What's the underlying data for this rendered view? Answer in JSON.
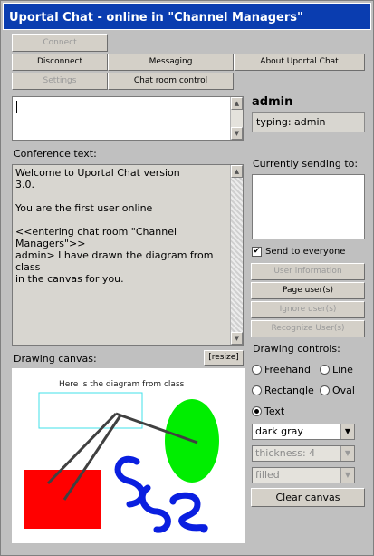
{
  "window": {
    "title": "Uportal Chat - online in \"Channel Managers\""
  },
  "toolbar": {
    "connect": "Connect",
    "disconnect": "Disconnect",
    "messaging": "Messaging",
    "about": "About Uportal Chat",
    "settings": "Settings",
    "chat_room_control": "Chat room control"
  },
  "input": {
    "value": ""
  },
  "user": {
    "name": "admin",
    "typing_status": "typing: admin"
  },
  "conference": {
    "label": "Conference text:",
    "text": "Welcome to Uportal Chat version\n3.0.\n\nYou are the first user online\n\n<<entering chat room \"Channel\nManagers\">>\nadmin> I have drawn the diagram from\nclass\nin the canvas for you."
  },
  "sending": {
    "label": "Currently sending to:",
    "send_to_everyone": "Send to everyone",
    "send_to_everyone_checked": true
  },
  "user_buttons": {
    "user_information": "User information",
    "page_users": "Page user(s)",
    "ignore_users": "Ignore user(s)",
    "recognize_users": "Recognize User(s)"
  },
  "canvas": {
    "label": "Drawing canvas:",
    "resize": "[resize]",
    "caption": "Here is the diagram from class",
    "colors": {
      "red": "#ff0000",
      "green": "#00ee00",
      "blue": "#0a1fe0",
      "cyan": "#40e0e8",
      "gray": "#404040"
    }
  },
  "drawing_controls": {
    "label": "Drawing controls:",
    "tools": [
      {
        "label": "Freehand",
        "selected": false
      },
      {
        "label": "Line",
        "selected": false
      },
      {
        "label": "Rectangle",
        "selected": false
      },
      {
        "label": "Oval",
        "selected": false
      },
      {
        "label": "Text",
        "selected": true
      }
    ],
    "color": "dark gray",
    "thickness": "thickness: 4",
    "fill": "filled",
    "clear": "Clear canvas"
  },
  "icons": {
    "up_arrow": "▲",
    "down_arrow": "▼",
    "dropdown_arrow": "▼",
    "check": "✔"
  }
}
